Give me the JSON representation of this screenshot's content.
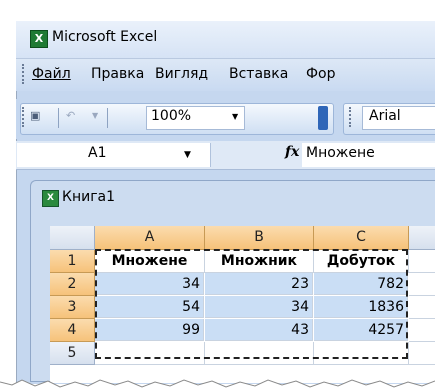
{
  "window": {
    "title": "Microsoft Excel",
    "app_icon": "excel-icon"
  },
  "menu": [
    {
      "label": "Файл"
    },
    {
      "label": "Правка"
    },
    {
      "label": "Вигляд"
    },
    {
      "label": "Вставка"
    },
    {
      "label": "Фор"
    }
  ],
  "toolbar": {
    "zoom": "100%",
    "font": "Arial"
  },
  "formula_bar": {
    "name_box": "A1",
    "fx": "fx",
    "formula": "Множене"
  },
  "workbook": {
    "title": "Книга1"
  },
  "sheet": {
    "columns": [
      "A",
      "B",
      "C"
    ],
    "rows": [
      {
        "num": "1",
        "cells": [
          "Множене",
          "Множник",
          "Добуток"
        ]
      },
      {
        "num": "2",
        "cells": [
          "34",
          "23",
          "782"
        ]
      },
      {
        "num": "3",
        "cells": [
          "54",
          "34",
          "1836"
        ]
      },
      {
        "num": "4",
        "cells": [
          "99",
          "43",
          "4257"
        ]
      },
      {
        "num": "5",
        "cells": [
          "",
          "",
          ""
        ]
      }
    ]
  }
}
